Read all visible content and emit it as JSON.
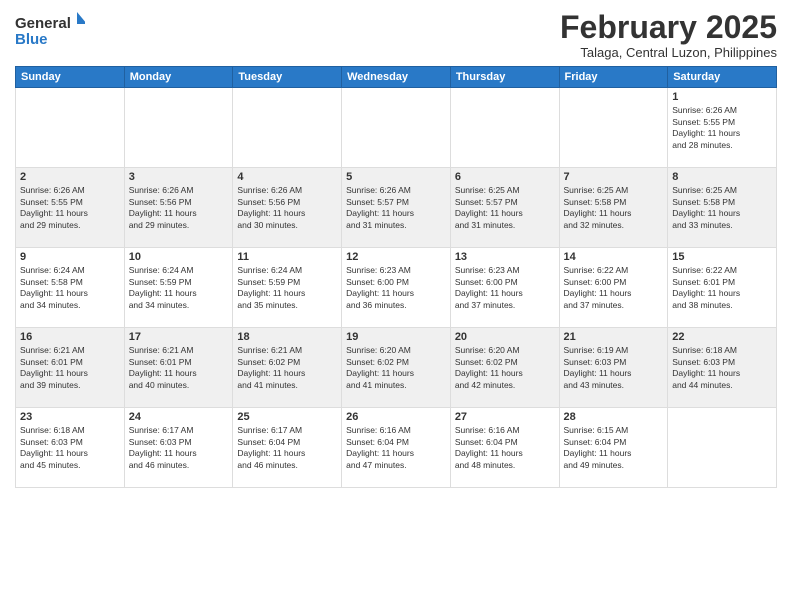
{
  "logo": {
    "line1": "General",
    "line2": "Blue"
  },
  "title": "February 2025",
  "location": "Talaga, Central Luzon, Philippines",
  "days_of_week": [
    "Sunday",
    "Monday",
    "Tuesday",
    "Wednesday",
    "Thursday",
    "Friday",
    "Saturday"
  ],
  "weeks": [
    [
      {
        "day": "",
        "info": ""
      },
      {
        "day": "",
        "info": ""
      },
      {
        "day": "",
        "info": ""
      },
      {
        "day": "",
        "info": ""
      },
      {
        "day": "",
        "info": ""
      },
      {
        "day": "",
        "info": ""
      },
      {
        "day": "1",
        "info": "Sunrise: 6:26 AM\nSunset: 5:55 PM\nDaylight: 11 hours\nand 28 minutes."
      }
    ],
    [
      {
        "day": "2",
        "info": "Sunrise: 6:26 AM\nSunset: 5:55 PM\nDaylight: 11 hours\nand 29 minutes."
      },
      {
        "day": "3",
        "info": "Sunrise: 6:26 AM\nSunset: 5:56 PM\nDaylight: 11 hours\nand 29 minutes."
      },
      {
        "day": "4",
        "info": "Sunrise: 6:26 AM\nSunset: 5:56 PM\nDaylight: 11 hours\nand 30 minutes."
      },
      {
        "day": "5",
        "info": "Sunrise: 6:26 AM\nSunset: 5:57 PM\nDaylight: 11 hours\nand 31 minutes."
      },
      {
        "day": "6",
        "info": "Sunrise: 6:25 AM\nSunset: 5:57 PM\nDaylight: 11 hours\nand 31 minutes."
      },
      {
        "day": "7",
        "info": "Sunrise: 6:25 AM\nSunset: 5:58 PM\nDaylight: 11 hours\nand 32 minutes."
      },
      {
        "day": "8",
        "info": "Sunrise: 6:25 AM\nSunset: 5:58 PM\nDaylight: 11 hours\nand 33 minutes."
      }
    ],
    [
      {
        "day": "9",
        "info": "Sunrise: 6:24 AM\nSunset: 5:58 PM\nDaylight: 11 hours\nand 34 minutes."
      },
      {
        "day": "10",
        "info": "Sunrise: 6:24 AM\nSunset: 5:59 PM\nDaylight: 11 hours\nand 34 minutes."
      },
      {
        "day": "11",
        "info": "Sunrise: 6:24 AM\nSunset: 5:59 PM\nDaylight: 11 hours\nand 35 minutes."
      },
      {
        "day": "12",
        "info": "Sunrise: 6:23 AM\nSunset: 6:00 PM\nDaylight: 11 hours\nand 36 minutes."
      },
      {
        "day": "13",
        "info": "Sunrise: 6:23 AM\nSunset: 6:00 PM\nDaylight: 11 hours\nand 37 minutes."
      },
      {
        "day": "14",
        "info": "Sunrise: 6:22 AM\nSunset: 6:00 PM\nDaylight: 11 hours\nand 37 minutes."
      },
      {
        "day": "15",
        "info": "Sunrise: 6:22 AM\nSunset: 6:01 PM\nDaylight: 11 hours\nand 38 minutes."
      }
    ],
    [
      {
        "day": "16",
        "info": "Sunrise: 6:21 AM\nSunset: 6:01 PM\nDaylight: 11 hours\nand 39 minutes."
      },
      {
        "day": "17",
        "info": "Sunrise: 6:21 AM\nSunset: 6:01 PM\nDaylight: 11 hours\nand 40 minutes."
      },
      {
        "day": "18",
        "info": "Sunrise: 6:21 AM\nSunset: 6:02 PM\nDaylight: 11 hours\nand 41 minutes."
      },
      {
        "day": "19",
        "info": "Sunrise: 6:20 AM\nSunset: 6:02 PM\nDaylight: 11 hours\nand 41 minutes."
      },
      {
        "day": "20",
        "info": "Sunrise: 6:20 AM\nSunset: 6:02 PM\nDaylight: 11 hours\nand 42 minutes."
      },
      {
        "day": "21",
        "info": "Sunrise: 6:19 AM\nSunset: 6:03 PM\nDaylight: 11 hours\nand 43 minutes."
      },
      {
        "day": "22",
        "info": "Sunrise: 6:18 AM\nSunset: 6:03 PM\nDaylight: 11 hours\nand 44 minutes."
      }
    ],
    [
      {
        "day": "23",
        "info": "Sunrise: 6:18 AM\nSunset: 6:03 PM\nDaylight: 11 hours\nand 45 minutes."
      },
      {
        "day": "24",
        "info": "Sunrise: 6:17 AM\nSunset: 6:03 PM\nDaylight: 11 hours\nand 46 minutes."
      },
      {
        "day": "25",
        "info": "Sunrise: 6:17 AM\nSunset: 6:04 PM\nDaylight: 11 hours\nand 46 minutes."
      },
      {
        "day": "26",
        "info": "Sunrise: 6:16 AM\nSunset: 6:04 PM\nDaylight: 11 hours\nand 47 minutes."
      },
      {
        "day": "27",
        "info": "Sunrise: 6:16 AM\nSunset: 6:04 PM\nDaylight: 11 hours\nand 48 minutes."
      },
      {
        "day": "28",
        "info": "Sunrise: 6:15 AM\nSunset: 6:04 PM\nDaylight: 11 hours\nand 49 minutes."
      },
      {
        "day": "",
        "info": ""
      }
    ]
  ]
}
